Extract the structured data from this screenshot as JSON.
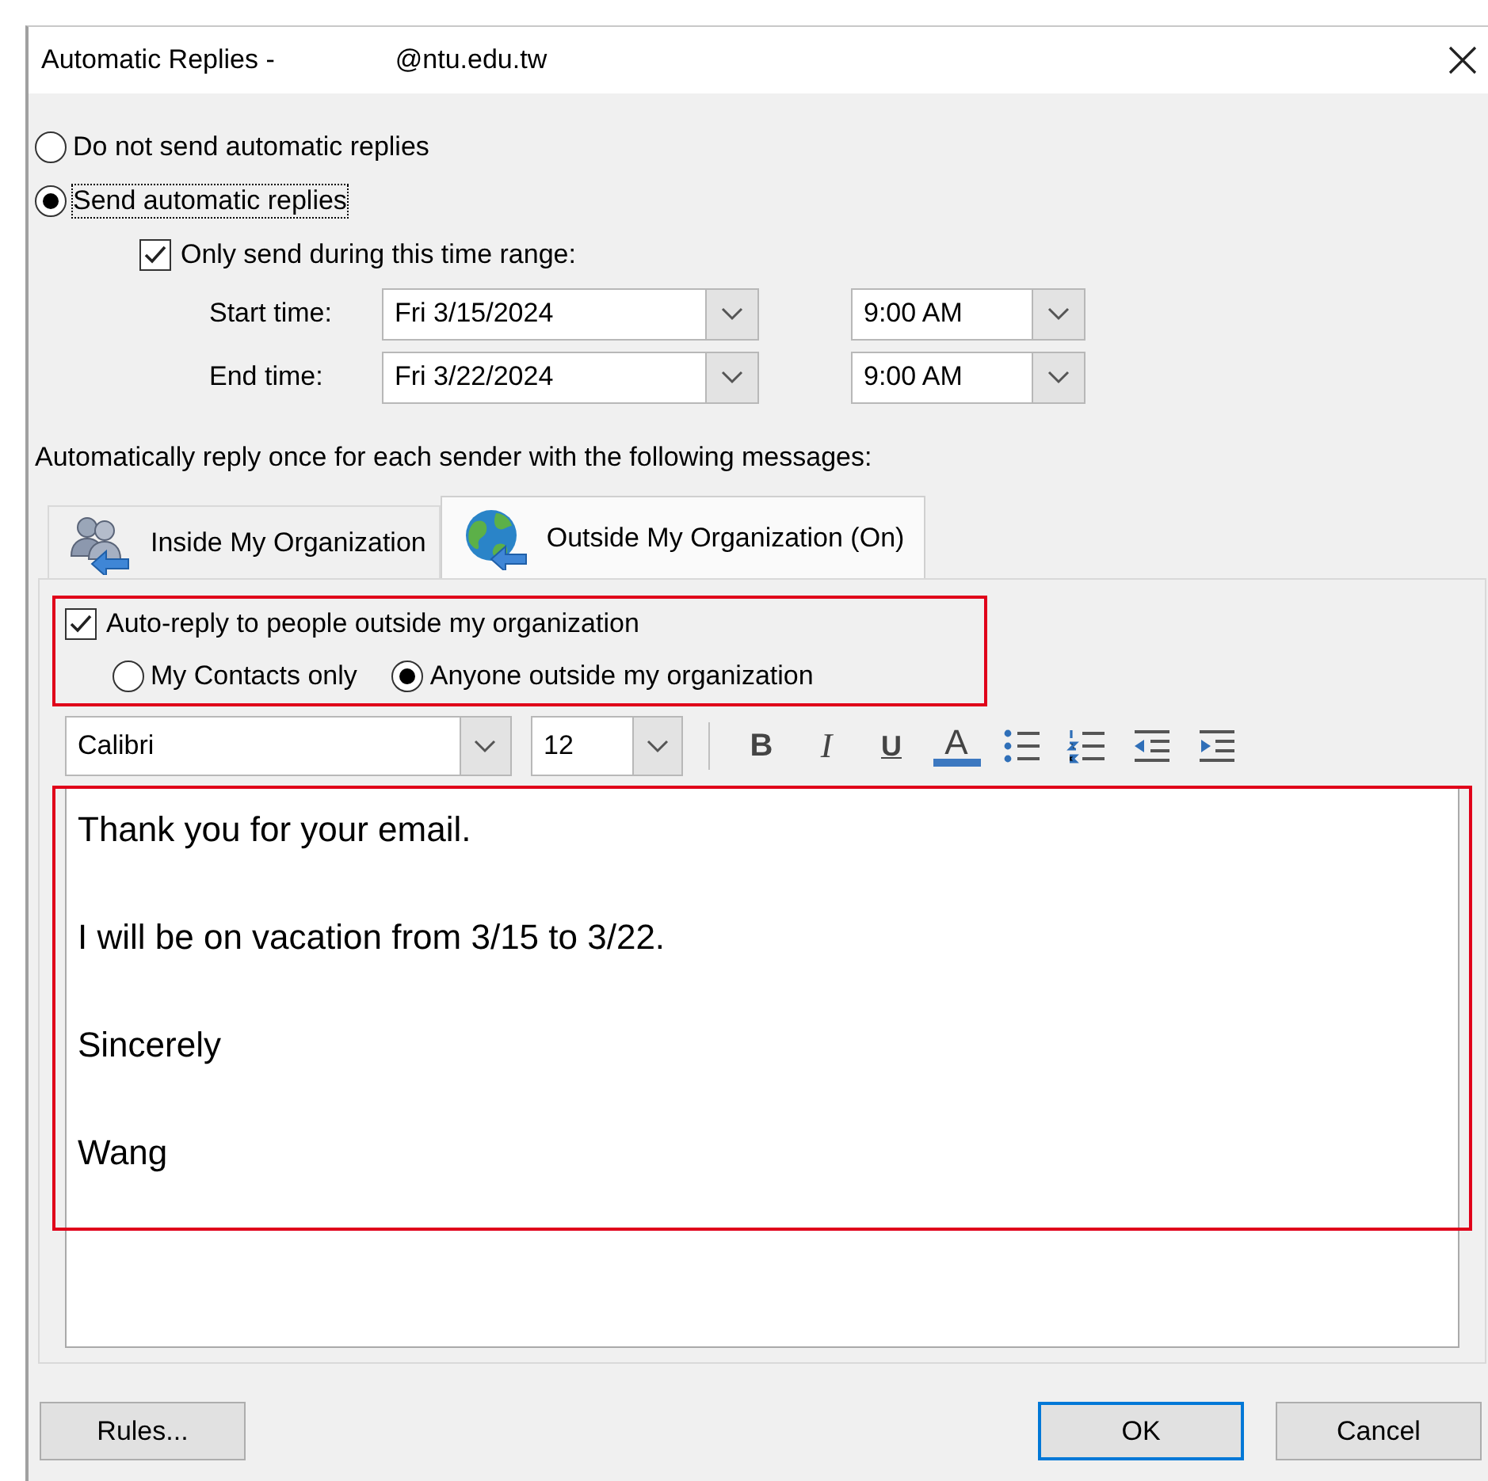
{
  "window": {
    "title": "Automatic Replies -",
    "account": "@ntu.edu.tw"
  },
  "reply_mode": [
    {
      "label": "Do not send automatic replies",
      "selected": false,
      "focused": false
    },
    {
      "label": "Send automatic replies",
      "selected": true,
      "focused": true
    }
  ],
  "time_range": {
    "label": "Only send during this time range:",
    "checked": true,
    "rows": [
      {
        "label": "Start time:",
        "date": "Fri 3/15/2024",
        "time": "9:00 AM"
      },
      {
        "label": "End time:",
        "date": "Fri 3/22/2024",
        "time": "9:00 AM"
      }
    ]
  },
  "intro": "Automatically reply once for each sender with the following messages:",
  "tabs": [
    {
      "label": "Inside My Organization",
      "selected": false,
      "kind": "people"
    },
    {
      "label": "Outside My Organization (On)",
      "selected": true,
      "kind": "globe"
    }
  ],
  "outside": {
    "highlighted": true,
    "auto_reply": {
      "label": "Auto-reply to people outside my organization",
      "checked": true
    },
    "audience": [
      {
        "label": "My Contacts only",
        "selected": false
      },
      {
        "label": "Anyone outside my organization",
        "selected": true
      }
    ]
  },
  "toolbar": {
    "font": "Calibri",
    "size": "12",
    "buttons": [
      {
        "kind": "bold",
        "label": "B"
      },
      {
        "kind": "italic",
        "label": "I"
      },
      {
        "kind": "underline",
        "label": "U"
      },
      {
        "kind": "color",
        "label": "A"
      },
      {
        "kind": "bullets"
      },
      {
        "kind": "numbering"
      },
      {
        "kind": "outdent"
      },
      {
        "kind": "indent"
      }
    ]
  },
  "message": {
    "highlighted": true,
    "paragraphs": [
      "Thank you for your email.",
      "I will be on vacation from 3/15 to 3/22.",
      "Sincerely",
      "Wang"
    ]
  },
  "buttons": [
    {
      "label": "Rules...",
      "kind": "secondary"
    },
    {
      "label": "OK",
      "kind": "default"
    },
    {
      "label": "Cancel",
      "kind": "secondary"
    }
  ]
}
